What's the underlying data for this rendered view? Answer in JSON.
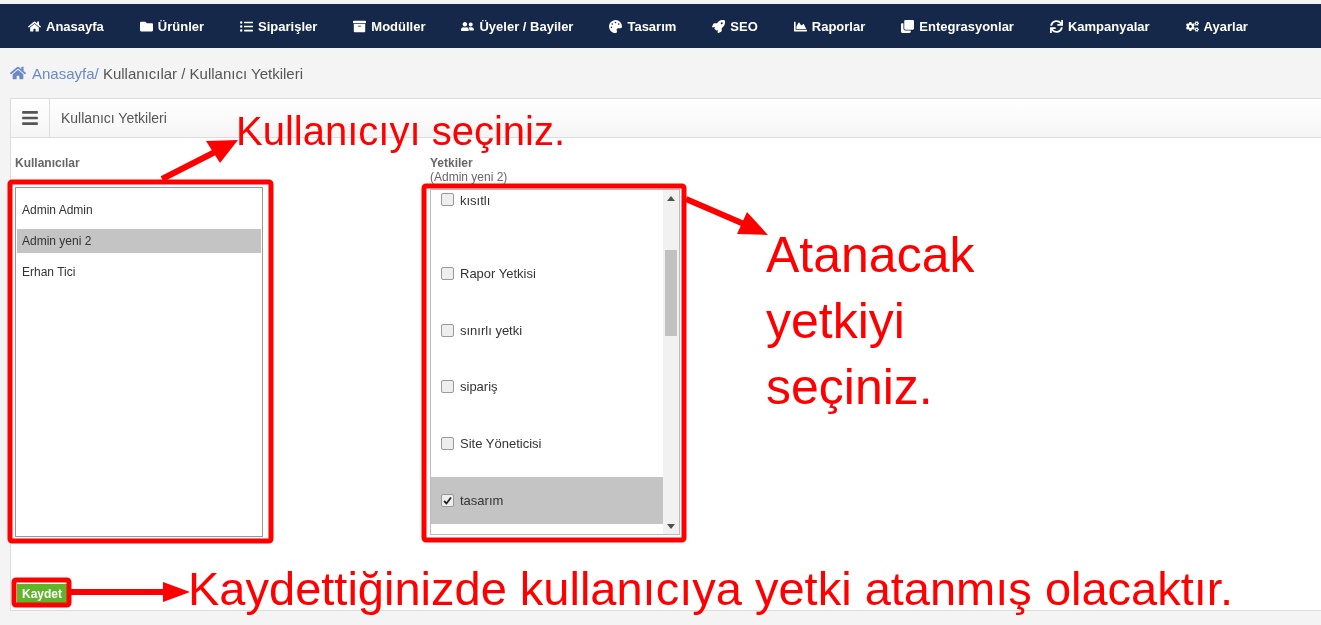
{
  "nav": [
    {
      "label": "Anasayfa"
    },
    {
      "label": "Ürünler"
    },
    {
      "label": "Siparişler"
    },
    {
      "label": "Modüller"
    },
    {
      "label": "Üyeler / Bayiler"
    },
    {
      "label": "Tasarım"
    },
    {
      "label": "SEO"
    },
    {
      "label": "Raporlar"
    },
    {
      "label": "Entegrasyonlar"
    },
    {
      "label": "Kampanyalar"
    },
    {
      "label": "Ayarlar"
    }
  ],
  "breadcrumb": {
    "link": "Anasayfa/",
    "rest": " Kullanıcılar / Kullanıcı Yetkileri"
  },
  "panel": {
    "title": "Kullanıcı Yetkileri"
  },
  "users": {
    "label": "Kullanıcılar",
    "items": [
      {
        "name": "Admin Admin",
        "selected": false
      },
      {
        "name": "Admin yeni 2",
        "selected": true
      },
      {
        "name": "Erhan Tici",
        "selected": false
      }
    ]
  },
  "permissions": {
    "label": "Yetkiler",
    "subtitle": "(Admin yeni 2)",
    "items": [
      {
        "name": "kısıtlı",
        "checked": false,
        "selected": false
      },
      {
        "name": "Rapor Yetkisi",
        "checked": false,
        "selected": false
      },
      {
        "name": "sınırlı yetki",
        "checked": false,
        "selected": false
      },
      {
        "name": "sipariş",
        "checked": false,
        "selected": false
      },
      {
        "name": "Site Yöneticisi",
        "checked": false,
        "selected": false
      },
      {
        "name": "tasarım",
        "checked": true,
        "selected": true
      }
    ]
  },
  "save_button": "Kaydet",
  "annotations": [
    {
      "text": "Kullanıcıyı seçiniz."
    },
    {
      "text": "Atanacak yetkiyi seçiniz."
    },
    {
      "text": "Kaydettiğinizde kullanıcıya yetki atanmış olacaktır."
    }
  ]
}
